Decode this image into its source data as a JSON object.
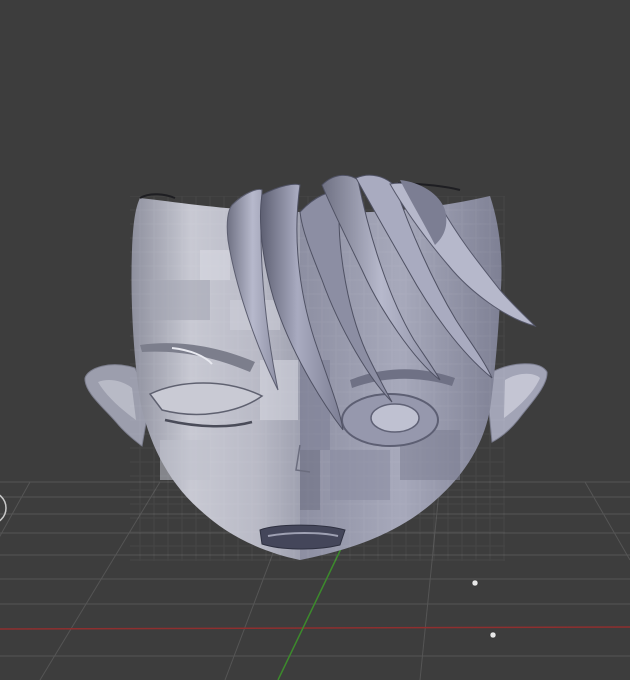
{
  "viewport": {
    "background": "#3d3d3d",
    "grid_color": "#545454",
    "x_axis_color": "#8f2f2f",
    "y_axis_color": "#3c8a2c",
    "mesh_color": "#b3b5c6",
    "mesh_shadow": "#6d6f80",
    "mesh_highlight": "#e4e5ef"
  },
  "scene": {
    "object": "head-mesh",
    "shading": "solid",
    "icons": [
      "navigation-gizmo-icon",
      "light-object-icon",
      "empty-object-icon"
    ]
  }
}
